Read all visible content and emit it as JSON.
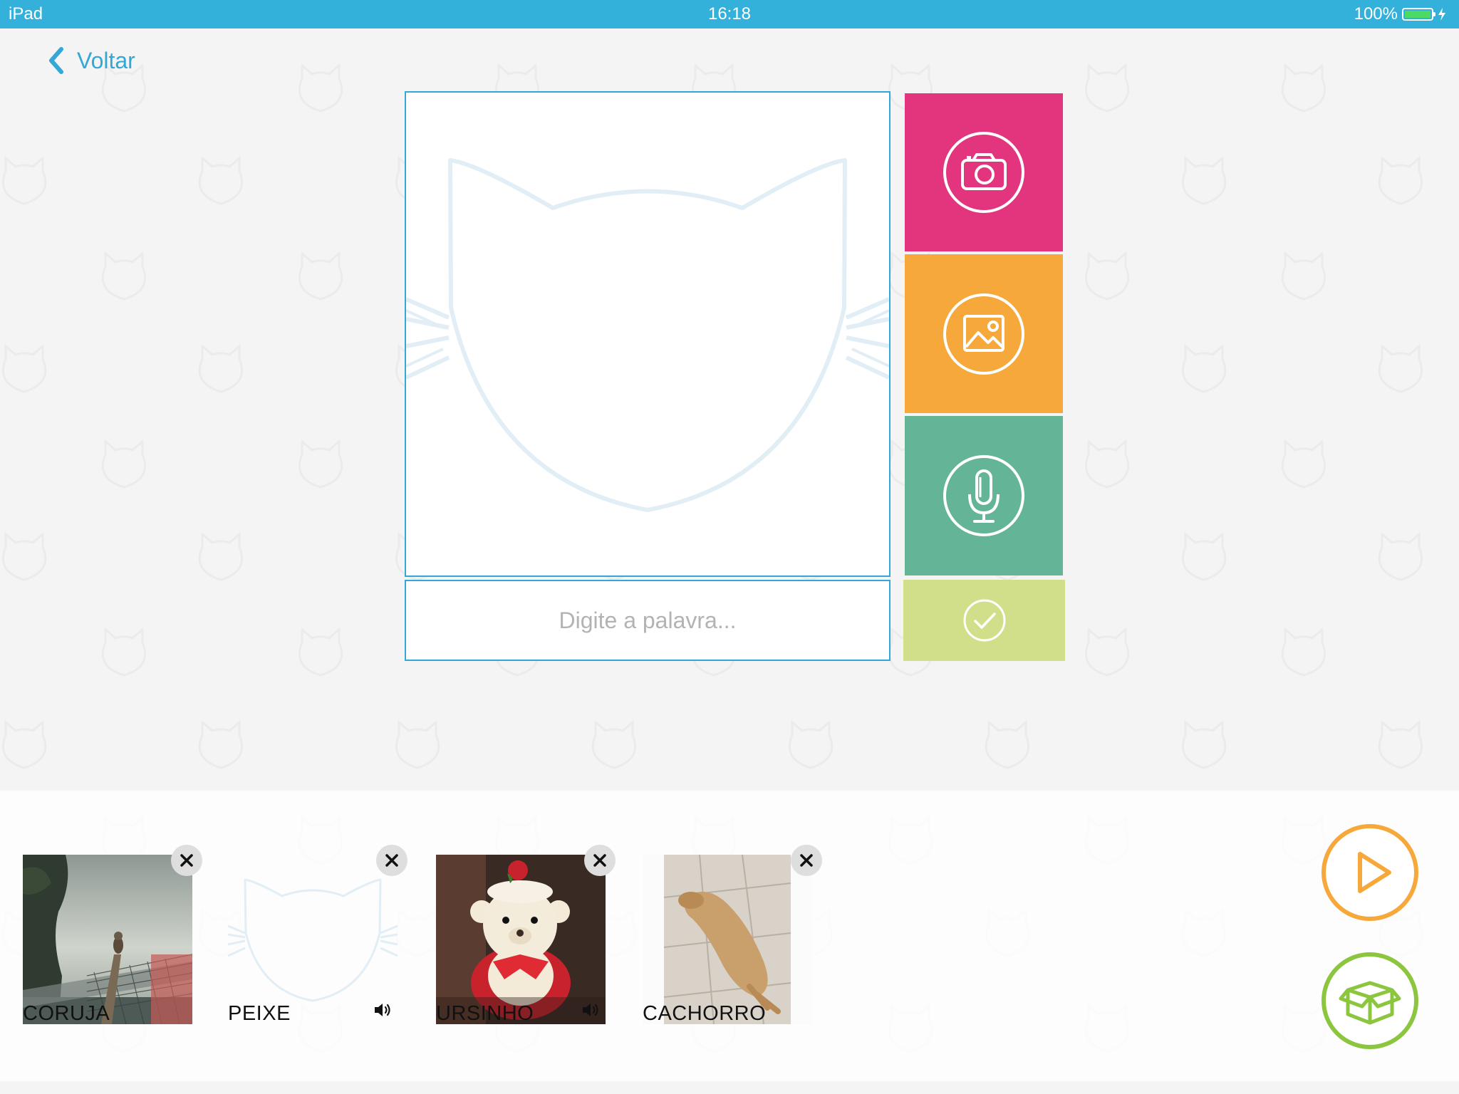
{
  "status_bar": {
    "device": "iPad",
    "time": "16:18",
    "battery": "100%",
    "battery_level": 1.0
  },
  "nav": {
    "back_label": "Voltar"
  },
  "editor": {
    "word_placeholder": "Digite a palavra...",
    "word_value": "",
    "tile_colors": {
      "camera": "#e2357e",
      "gallery": "#f6a93a",
      "mic": "#64b497",
      "check": "#d2df8a"
    }
  },
  "cards": [
    {
      "label": "CORUJA",
      "has_audio": false,
      "image": "owl-photo"
    },
    {
      "label": "PEIXE",
      "has_audio": true,
      "image": "cat-placeholder"
    },
    {
      "label": "URSINHO",
      "has_audio": true,
      "image": "teddy-bear-photo"
    },
    {
      "label": "CACHORRO",
      "has_audio": false,
      "image": "dog-photo"
    }
  ],
  "actions": {
    "play_color": "#f6a93a",
    "save_color": "#8cc63f"
  },
  "icons": [
    "back-chevron-icon",
    "camera-icon",
    "image-icon",
    "microphone-icon",
    "check-icon",
    "close-icon",
    "speaker-icon",
    "play-icon",
    "box-icon"
  ]
}
